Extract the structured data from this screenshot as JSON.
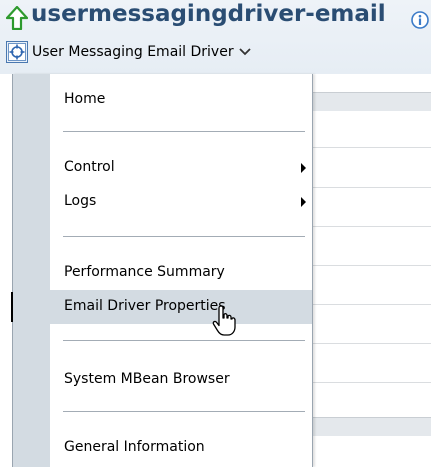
{
  "header": {
    "title": "usermessagingdriver-email",
    "driver_menu_label": "User Messaging Email Driver"
  },
  "menu": {
    "items": [
      {
        "label": "Home"
      },
      {
        "label": "Control",
        "submenu": true
      },
      {
        "label": "Logs",
        "submenu": true
      },
      {
        "label": "Performance Summary"
      },
      {
        "label": "Email Driver Properties",
        "highlighted": true
      },
      {
        "label": "System MBean Browser"
      },
      {
        "label": "General Information"
      }
    ]
  },
  "colors": {
    "title": "#2a4d73",
    "gutter": "#d3dbe2",
    "highlight": "#d3dbe2",
    "up_arrow": "#2e9a2e"
  },
  "icons": [
    "up-arrow-icon",
    "info-icon",
    "target-icon",
    "chevron-down-icon",
    "submenu-arrow-icon",
    "mouse-pointer-icon"
  ]
}
